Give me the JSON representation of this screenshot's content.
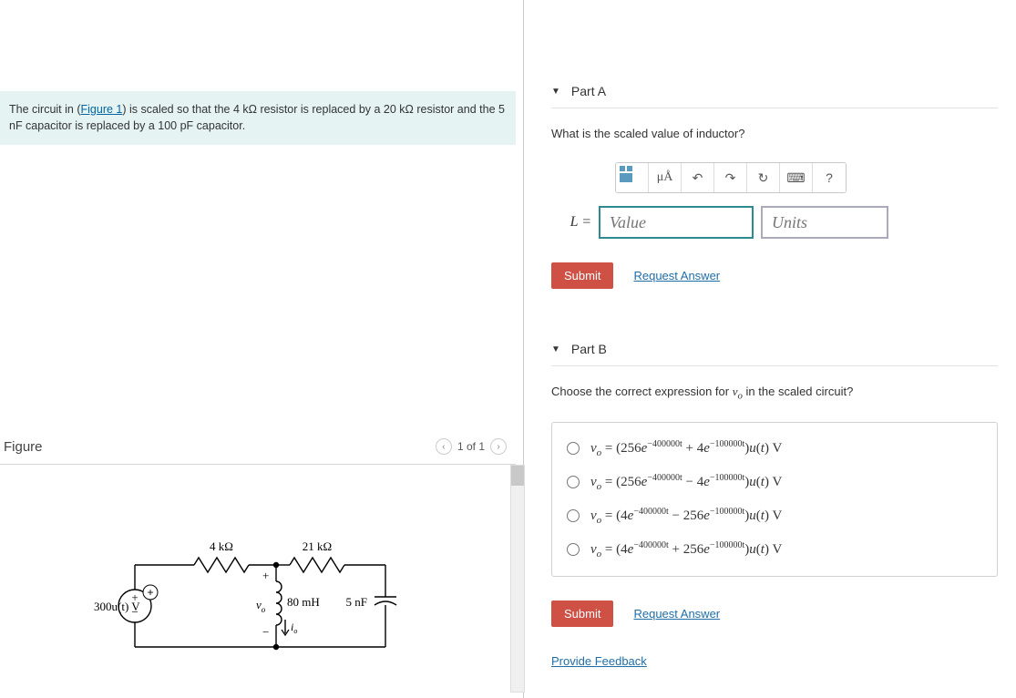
{
  "problem": {
    "statement_prefix": "The circuit in (",
    "figure_link": "Figure 1",
    "statement_suffix": ") is scaled so that the 4 kΩ resistor is replaced by a 20 kΩ resistor and the 5 nF capacitor is replaced by a 100 pF capacitor."
  },
  "figure": {
    "title": "Figure",
    "pager": "1 of 1",
    "labels": {
      "source": "300u(t) V",
      "r1": "4 kΩ",
      "r2": "21 kΩ",
      "vo_plus": "+",
      "vo_minus": "−",
      "vo": "v",
      "vo_sub": "o",
      "inductor": "80 mH",
      "io": "i",
      "io_sub": "o",
      "cap": "5 nF",
      "src_plus": "+",
      "src_minus": "−"
    }
  },
  "partA": {
    "title": "Part A",
    "question": "What is the scaled value of inductor?",
    "toolbar": {
      "mu": "μÅ",
      "undo": "↶",
      "redo": "↷",
      "reset": "↻",
      "keyboard": "⌨",
      "help": "?"
    },
    "label": "L =",
    "value_placeholder": "Value",
    "units_placeholder": "Units",
    "submit": "Submit",
    "request": "Request Answer"
  },
  "partB": {
    "title": "Part B",
    "question_prefix": "Choose the correct expression for ",
    "question_var": "v",
    "question_sub": "o",
    "question_suffix": " in the scaled circuit?",
    "options": [
      {
        "a": "256",
        "s1": "−400000t",
        "op": "+",
        "b": "4",
        "s2": "−100000t"
      },
      {
        "a": "256",
        "s1": "−400000t",
        "op": "−",
        "b": "4",
        "s2": "−100000t"
      },
      {
        "a": "4",
        "s1": "−400000t",
        "op": "−",
        "b": "256",
        "s2": "−100000t"
      },
      {
        "a": "4",
        "s1": "−400000t",
        "op": "+",
        "b": "256",
        "s2": "−100000t"
      }
    ],
    "submit": "Submit",
    "request": "Request Answer"
  },
  "feedback": "Provide Feedback"
}
